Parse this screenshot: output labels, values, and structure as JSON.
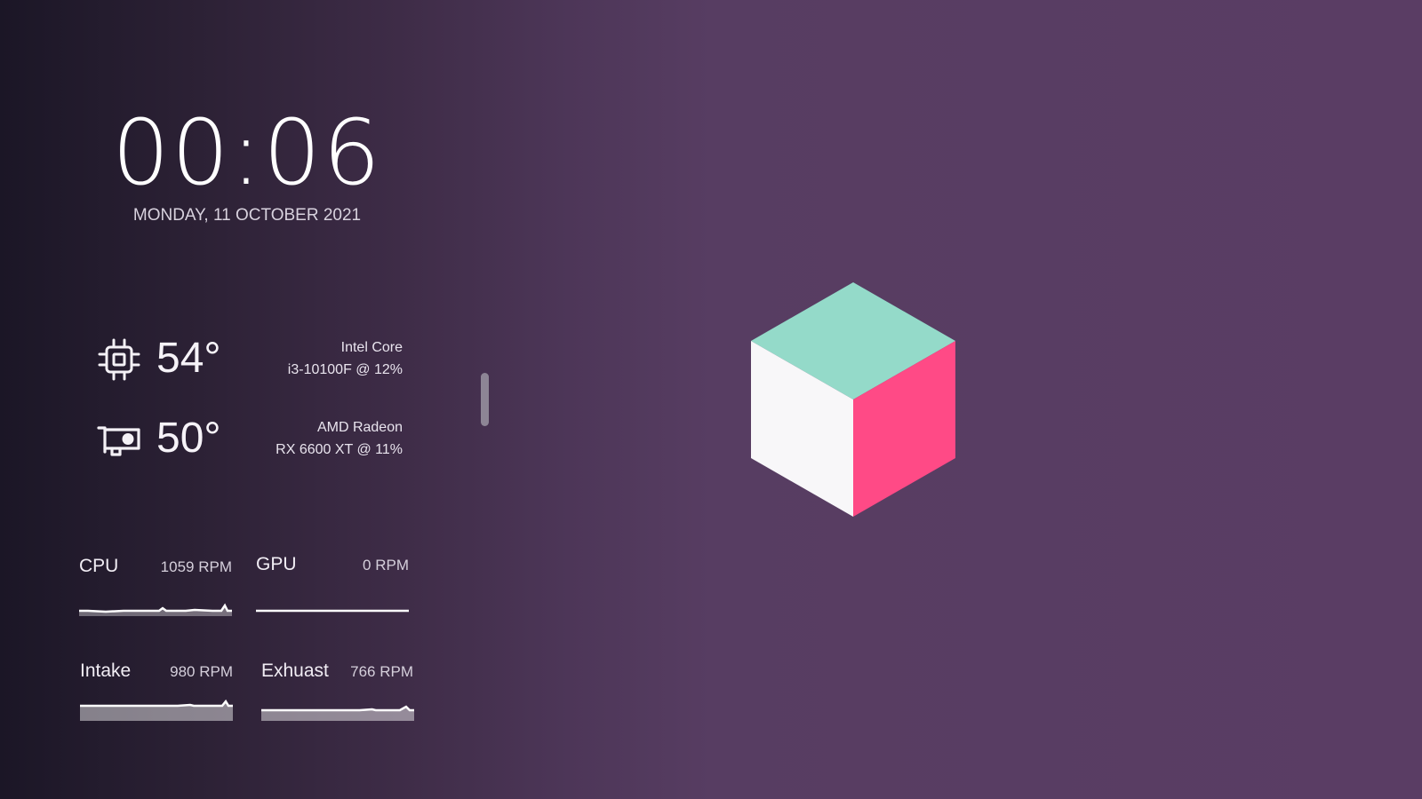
{
  "clock": {
    "time": "00:06",
    "date": "MONDAY, 11 OCTOBER 2021"
  },
  "temps": {
    "cpu": {
      "icon": "cpu-chip-icon",
      "value": "54°",
      "name": "Intel Core",
      "detail": "i3-10100F @ 12%"
    },
    "gpu": {
      "icon": "graphics-card-icon",
      "value": "50°",
      "name": "AMD Radeon",
      "detail": "RX 6600 XT @ 11%"
    }
  },
  "fans": {
    "cpu": {
      "name": "CPU",
      "rpm": "1059 RPM"
    },
    "gpu": {
      "name": "GPU",
      "rpm": "0 RPM"
    },
    "intake": {
      "name": "Intake",
      "rpm": "980 RPM"
    },
    "exhaust": {
      "name": "Exhuast",
      "rpm": "766 RPM"
    }
  },
  "logo": {
    "icon": "isometric-cube-logo",
    "colors": {
      "top": "#94dac9",
      "left": "#f8f7f9",
      "right": "#ff4a86"
    }
  },
  "colors": {
    "background_left": "#1b1626",
    "background_right": "#5a3d64",
    "text": "#f1edf4"
  }
}
